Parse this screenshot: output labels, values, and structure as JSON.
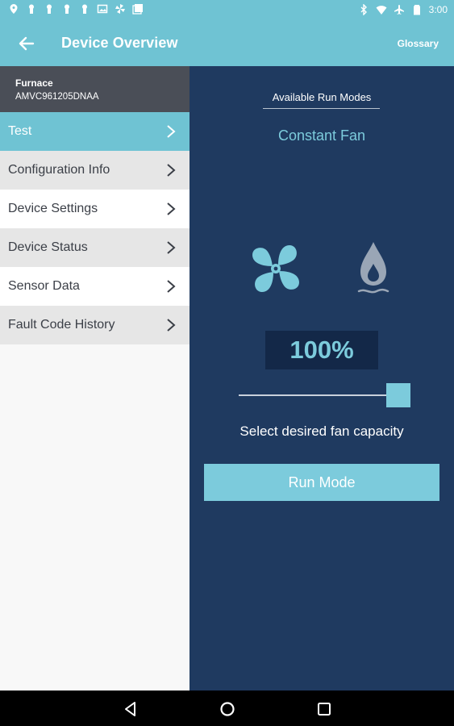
{
  "status_bar": {
    "time": "3:00",
    "left_icons": [
      "location-pin-icon",
      "keyhole-icon",
      "keyhole-icon",
      "keyhole-icon",
      "keyhole-icon",
      "image-icon",
      "pinwheel-icon",
      "gallery-icon"
    ],
    "right_icons": [
      "bluetooth-icon",
      "wifi-icon",
      "airplane-icon",
      "battery-icon"
    ]
  },
  "app_bar": {
    "title": "Device Overview",
    "glossary_label": "Glossary",
    "back_icon": "arrow-left-icon"
  },
  "device": {
    "type": "Furnace",
    "model": "AMVC961205DNAA"
  },
  "sidebar": {
    "items": [
      {
        "label": "Test"
      },
      {
        "label": "Configuration Info"
      },
      {
        "label": "Device Settings"
      },
      {
        "label": "Device Status"
      },
      {
        "label": "Sensor Data"
      },
      {
        "label": "Fault Code History"
      }
    ],
    "selected_index": 0
  },
  "main": {
    "modes_label": "Available Run Modes",
    "mode_name": "Constant Fan",
    "capacity_value": "100%",
    "slider_percent": 100,
    "select_label": "Select desired fan capacity",
    "run_button_label": "Run Mode",
    "icons": [
      "fan-icon",
      "flame-icon"
    ]
  },
  "colors": {
    "accent": "#6fc3d3",
    "panel_bg": "#1f3a60",
    "capacity_box": "#132848",
    "header_gray": "#4a4e57",
    "light_accent": "#7ccbdc"
  },
  "nav_bar": {
    "icons": [
      "back-triangle-icon",
      "home-circle-icon",
      "recents-square-icon"
    ]
  }
}
